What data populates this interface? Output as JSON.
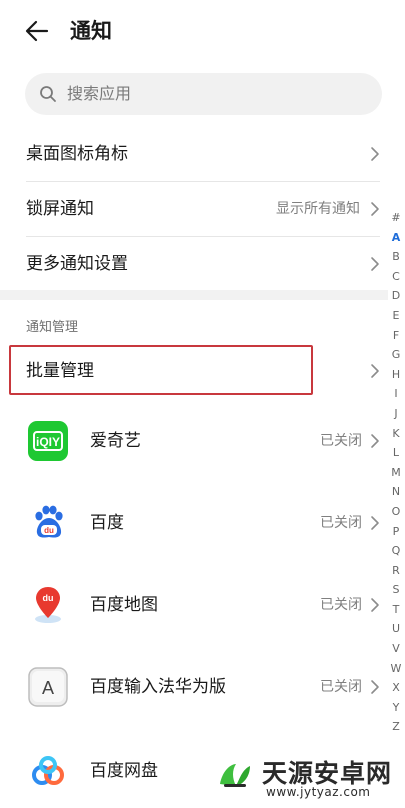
{
  "header": {
    "title": "通知"
  },
  "search": {
    "placeholder": "搜索应用"
  },
  "settings": [
    {
      "label": "桌面图标角标",
      "value": ""
    },
    {
      "label": "锁屏通知",
      "value": "显示所有通知"
    },
    {
      "label": "更多通知设置",
      "value": ""
    }
  ],
  "section": {
    "title": "通知管理",
    "batch_label": "批量管理"
  },
  "apps": [
    {
      "name": "爱奇艺",
      "status": "已关闭",
      "icon": "iqiyi-icon"
    },
    {
      "name": "百度",
      "status": "已关闭",
      "icon": "baidu-paw-icon"
    },
    {
      "name": "百度地图",
      "status": "已关闭",
      "icon": "baidu-map-icon"
    },
    {
      "name": "百度输入法华为版",
      "status": "已关闭",
      "icon": "baidu-input-icon"
    },
    {
      "name": "百度网盘",
      "status": "",
      "icon": "baidu-netdisk-icon"
    }
  ],
  "alphabet_index": [
    "#",
    "A",
    "B",
    "C",
    "D",
    "E",
    "F",
    "G",
    "H",
    "I",
    "J",
    "K",
    "L",
    "M",
    "N",
    "O",
    "P",
    "Q",
    "R",
    "S",
    "T",
    "U",
    "V",
    "W",
    "X",
    "Y",
    "Z"
  ],
  "alphabet_active": "A",
  "colors": {
    "highlight": "#c8383d",
    "index_active": "#1f6dd9",
    "iqiyi_green": "#1ec832",
    "baidu_blue": "#2a6de2"
  },
  "watermark": {
    "name": "天源安卓网",
    "url": "www.jytyaz.com"
  }
}
